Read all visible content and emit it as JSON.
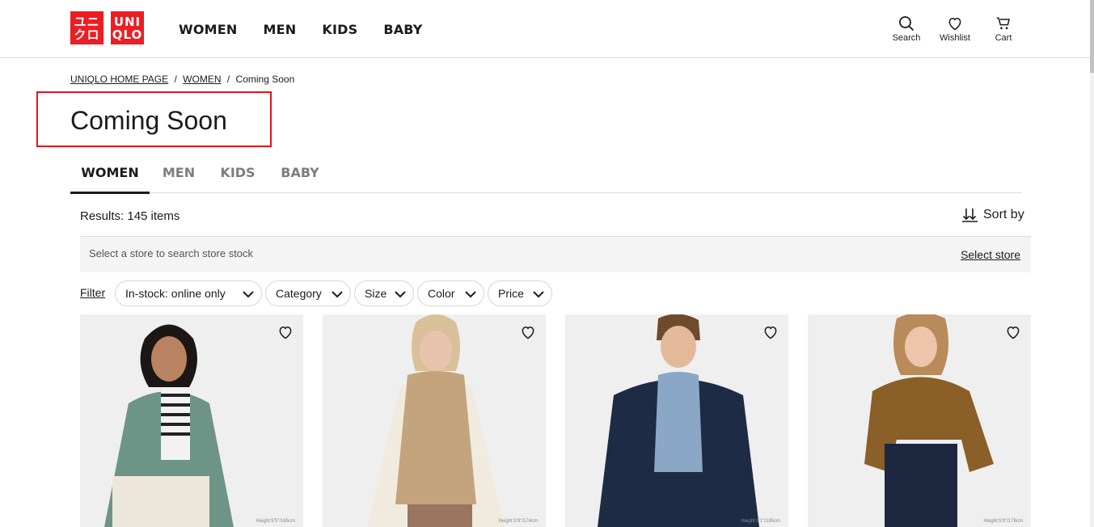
{
  "brand": {
    "logo_left_line1": "ユニ",
    "logo_left_line2": "クロ",
    "logo_right_line1": "UNI",
    "logo_right_line2": "QLO",
    "color": "#ed1d24"
  },
  "header": {
    "nav": [
      "WOMEN",
      "MEN",
      "KIDS",
      "BABY"
    ],
    "search_label": "Search",
    "wishlist_label": "Wishlist",
    "cart_label": "Cart"
  },
  "breadcrumb": {
    "home": "UNIQLO HOME PAGE",
    "sep1": "/",
    "women": "WOMEN",
    "sep2": "/",
    "current": "Coming Soon"
  },
  "page": {
    "title": "Coming Soon",
    "highlight_color": "#e0151c"
  },
  "tabs": [
    {
      "label": "WOMEN",
      "active": true
    },
    {
      "label": "MEN",
      "active": false
    },
    {
      "label": "KIDS",
      "active": false
    },
    {
      "label": "BABY",
      "active": false
    }
  ],
  "results": {
    "text": "Results: 145 items",
    "sort_label": "Sort by"
  },
  "store": {
    "hint": "Select a store to search store stock",
    "link": "Select store"
  },
  "filters": {
    "filter_link": "Filter",
    "chips": [
      "In-stock: online only",
      "Category",
      "Size",
      "Color",
      "Price"
    ]
  },
  "products": [
    {
      "model_note": "Height:5'5\"/165cm",
      "garment_color": "#6e9487",
      "icon": "heart-icon"
    },
    {
      "model_note": "Height:5'9\"/174cm",
      "garment_color": "#c4a47c",
      "icon": "heart-icon"
    },
    {
      "model_note": "Height:6'1\"/185cm",
      "garment_color": "#1e2b45",
      "icon": "heart-icon"
    },
    {
      "model_note": "Height:5'9\"/176cm",
      "garment_color": "#8a5f28",
      "icon": "heart-icon"
    }
  ]
}
